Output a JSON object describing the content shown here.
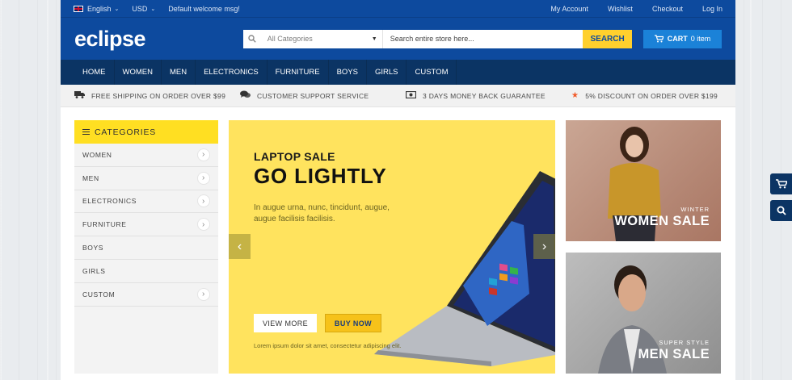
{
  "topbar": {
    "language": "English",
    "currency": "USD",
    "welcome": "Default welcome msg!",
    "links": [
      "My Account",
      "Wishlist",
      "Checkout",
      "Log In"
    ]
  },
  "header": {
    "logo": "eclipse",
    "search": {
      "category": "All Categories",
      "placeholder": "Search entire store here...",
      "button": "SEARCH"
    },
    "cart": {
      "label": "CART",
      "count": "0 item"
    }
  },
  "nav": [
    "HOME",
    "WOMEN",
    "MEN",
    "ELECTRONICS",
    "FURNITURE",
    "BOYS",
    "GIRLS",
    "CUSTOM"
  ],
  "features": [
    {
      "icon": "truck-icon",
      "text": "FREE SHIPPING ON ORDER OVER $99"
    },
    {
      "icon": "chat-icon",
      "text": "CUSTOMER SUPPORT SERVICE"
    },
    {
      "icon": "money-icon",
      "text": "3 DAYS MONEY BACK GUARANTEE"
    },
    {
      "icon": "star-icon",
      "text": "5% DISCOUNT ON ORDER OVER $199"
    }
  ],
  "sidebar": {
    "title": "CATEGORIES",
    "items": [
      {
        "label": "WOMEN",
        "arrow": true
      },
      {
        "label": "MEN",
        "arrow": true
      },
      {
        "label": "ELECTRONICS",
        "arrow": true
      },
      {
        "label": "FURNITURE",
        "arrow": true
      },
      {
        "label": "BOYS",
        "arrow": false
      },
      {
        "label": "GIRLS",
        "arrow": false
      },
      {
        "label": "CUSTOM",
        "arrow": true
      }
    ]
  },
  "banner": {
    "kicker": "LAPTOP SALE",
    "headline": "GO LIGHTLY",
    "description": "In augue urna, nunc, tincidunt, augue, augue facilisis facilisis.",
    "view_more": "VIEW MORE",
    "buy_now": "BUY NOW",
    "footnote": "Lorem ipsum dolor sit amet, consectetur adipiscing elit."
  },
  "promos": {
    "women": {
      "sub": "WINTER",
      "title": "WOMEN SALE"
    },
    "men": {
      "sub": "SUPER STYLE",
      "title": "MEN SALE"
    }
  },
  "colors": {
    "brand_blue": "#0d4a9e",
    "nav_dark": "#0b3464",
    "accent_yellow": "#ffd02d",
    "cart_blue": "#1b82d8"
  }
}
